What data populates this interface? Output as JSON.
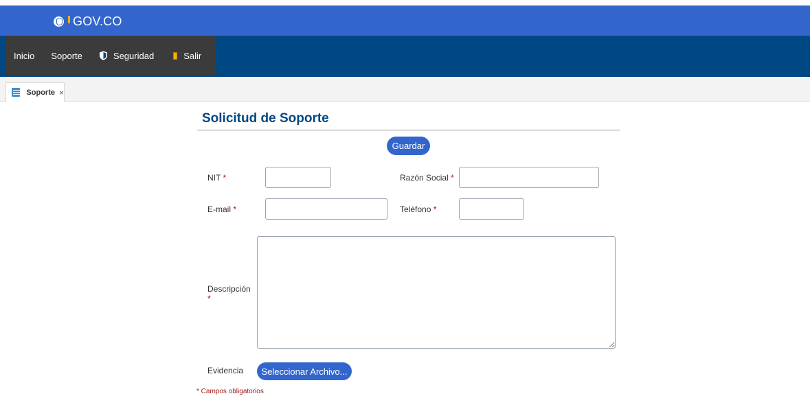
{
  "header": {
    "brand_text": "GOV.CO",
    "brand_icon": "colombia-seal-icon",
    "primary_color": "#3366cc",
    "secondary_color": "#004884"
  },
  "nav": {
    "items": [
      {
        "label": "Inicio"
      },
      {
        "label": "Soporte"
      },
      {
        "label": "Seguridad",
        "icon": "shield-icon"
      },
      {
        "label": "Salir",
        "icon": "exit-door-icon"
      }
    ]
  },
  "tabs": [
    {
      "label": "Soporte",
      "icon": "form-icon",
      "close": "×"
    }
  ],
  "form": {
    "title": "Solicitud de Soporte",
    "save_label": "Guardar",
    "fields": {
      "nit": {
        "label": "NIT",
        "required_mark": "*",
        "value": ""
      },
      "razon_social": {
        "label": "Razón Social",
        "required_mark": "*",
        "value": ""
      },
      "email": {
        "label": "E-mail",
        "required_mark": "*",
        "value": ""
      },
      "telefono": {
        "label": "Teléfono",
        "required_mark": "*",
        "value": ""
      },
      "descripcion": {
        "label": "Descripción",
        "required_mark": "*",
        "value": ""
      },
      "evidencia": {
        "label": "Evidencia",
        "button_label": "Seleccionar Archivo..."
      }
    },
    "required_note": "* Campos obligatorios"
  }
}
